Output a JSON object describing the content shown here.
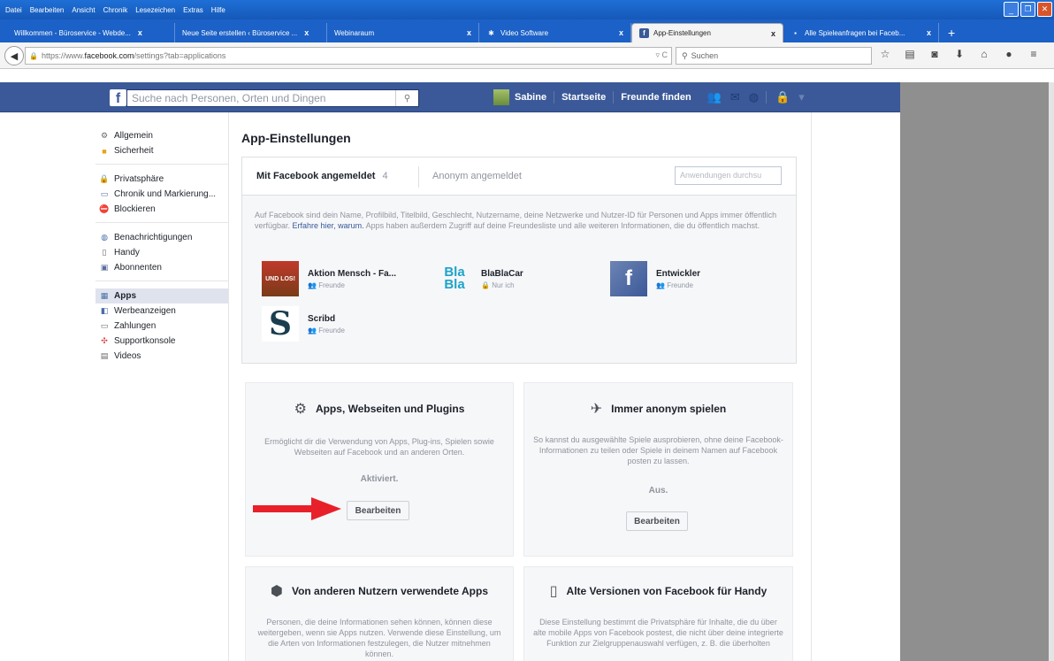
{
  "browser": {
    "menu": [
      "Datei",
      "Bearbeiten",
      "Ansicht",
      "Chronik",
      "Lesezeichen",
      "Extras",
      "Hilfe"
    ],
    "tabs": [
      {
        "label": "Willkommen - Büroservice - Webde...",
        "close": "x"
      },
      {
        "label": "Neue Seite erstellen ‹ Büroservice ...",
        "close": "x"
      },
      {
        "label": "Webinaraum",
        "close": "x"
      },
      {
        "label": "Video Software",
        "close": "x"
      },
      {
        "label": "App-Einstellungen",
        "close": "x"
      },
      {
        "label": "Alle Spieleanfragen bei Faceb...",
        "close": "x"
      }
    ],
    "newtab": "+",
    "url_prefix": "https://www.",
    "url_domain": "facebook.com",
    "url_path": "/settings?tab=applications",
    "search_placeholder": "Suchen"
  },
  "fb": {
    "search_placeholder": "Suche nach Personen, Orten und Dingen",
    "user": "Sabine",
    "home": "Startseite",
    "find_friends": "Freunde finden"
  },
  "sidebar": {
    "groups": [
      [
        "Allgemein",
        "Sicherheit"
      ],
      [
        "Privatsphäre",
        "Chronik und Markierung...",
        "Blockieren"
      ],
      [
        "Benachrichtigungen",
        "Handy",
        "Abonnenten"
      ],
      [
        "Apps",
        "Werbeanzeigen",
        "Zahlungen",
        "Supportkonsole",
        "Videos"
      ]
    ],
    "selected": "Apps"
  },
  "main": {
    "title": "App-Einstellungen",
    "tab_logged_in": "Mit Facebook angemeldet",
    "tab_logged_in_count": "4",
    "tab_anonymous": "Anonym angemeldet",
    "app_search_placeholder": "Anwendungen durchsu",
    "desc_a": "Auf Facebook sind dein Name, Profilbild, Titelbild, Geschlecht, Nutzername, deine Netzwerke und Nutzer-ID für Personen und Apps immer öffentlich verfügbar.",
    "desc_link": "Erfahre hier, warum.",
    "desc_b": "Apps haben außerdem Zugriff auf deine Freundesliste und alle weiteren Informationen, die du öffentlich machst.",
    "apps": [
      {
        "name": "Aktion Mensch - Fa...",
        "visibility": "Freunde",
        "thumb": "UND LOS!"
      },
      {
        "name": "BlaBlaCar",
        "visibility": "Nur ich",
        "thumb": "Bla Bla"
      },
      {
        "name": "Entwickler",
        "visibility": "Freunde",
        "thumb": "f"
      },
      {
        "name": "Scribd",
        "visibility": "Freunde",
        "thumb": "S"
      }
    ],
    "cards": [
      {
        "title": "Apps, Webseiten und Plugins",
        "desc": "Ermöglicht dir die Verwendung von Apps, Plug-ins, Spielen sowie Webseiten auf Facebook und an anderen Orten.",
        "status": "Aktiviert.",
        "button": "Bearbeiten"
      },
      {
        "title": "Immer anonym spielen",
        "desc": "So kannst du ausgewählte Spiele ausprobieren, ohne deine Facebook-Informationen zu teilen oder Spiele in deinem Namen auf Facebook posten zu lassen.",
        "status": "Aus.",
        "button": "Bearbeiten"
      },
      {
        "title": "Von anderen Nutzern verwendete Apps",
        "desc": "Personen, die deine Informationen sehen können, können diese weitergeben, wenn sie Apps nutzen. Verwende diese Einstellung, um die Arten von Informationen festzulegen, die Nutzer mitnehmen können."
      },
      {
        "title": "Alte Versionen von Facebook für Handy",
        "desc": "Diese Einstellung bestimmt die Privatsphäre für Inhalte, die du über alte mobile Apps von Facebook postest, die nicht über deine integrierte Funktion zur Zielgruppenauswahl verfügen, z. B. die überholten"
      }
    ]
  },
  "colors": {
    "fb_blue": "#3b5998",
    "arrow_red": "#e8202a",
    "win_blue": "#1c61c7"
  }
}
